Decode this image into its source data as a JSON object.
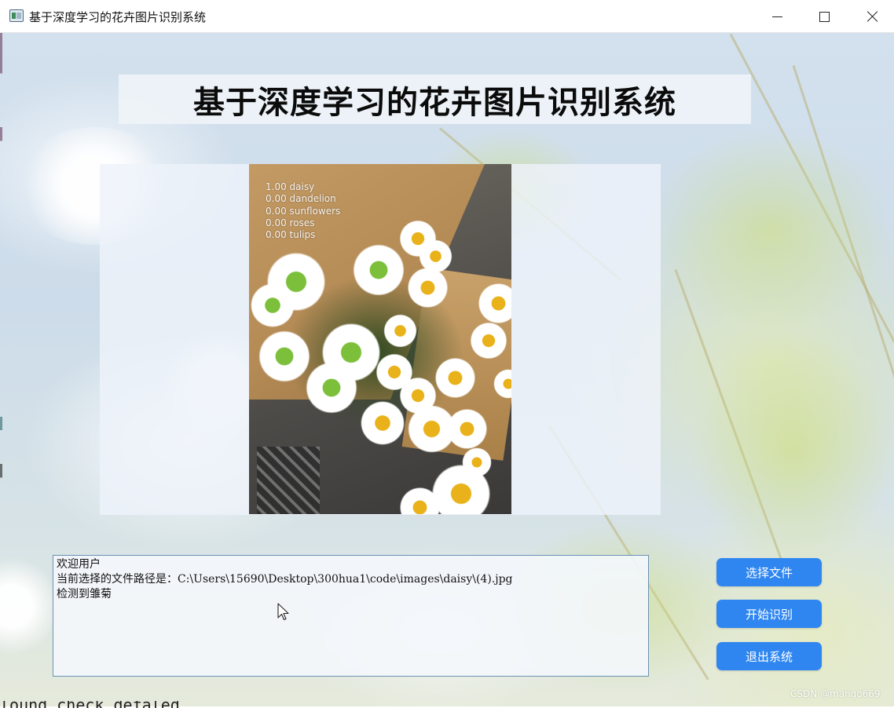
{
  "window": {
    "title": "基于深度学习的花卉图片识别系统",
    "controls": {
      "minimize": "minimize",
      "maximize": "maximize",
      "close": "close"
    }
  },
  "header": {
    "title": "基于深度学习的花卉图片识别系统"
  },
  "image_panel": {
    "predictions": [
      {
        "score": "1.00",
        "label": "daisy",
        "text": "1.00 daisy"
      },
      {
        "score": "0.00",
        "label": "dandelion",
        "text": "0.00 dandelion"
      },
      {
        "score": "0.00",
        "label": "sunflowers",
        "text": "0.00 sunflowers"
      },
      {
        "score": "0.00",
        "label": "roses",
        "text": "0.00 roses"
      },
      {
        "score": "0.00",
        "label": "tulips",
        "text": "0.00 tulips"
      }
    ]
  },
  "log": {
    "lines": [
      "欢迎用户",
      "当前选择的文件路径是：C:\\Users\\15690\\Desktop\\300hua1\\code\\images\\daisy\\(4).jpg",
      "检测到雏菊"
    ]
  },
  "buttons": {
    "select_file": "选择文件",
    "start_recognition": "开始识别",
    "exit_system": "退出系统"
  },
  "colors": {
    "button_bg": "#2f86f0",
    "button_text": "#ffffff",
    "log_border": "#6a92b5"
  },
  "watermark": "CSDN @mango669",
  "background_text": "lound  check  defaled"
}
